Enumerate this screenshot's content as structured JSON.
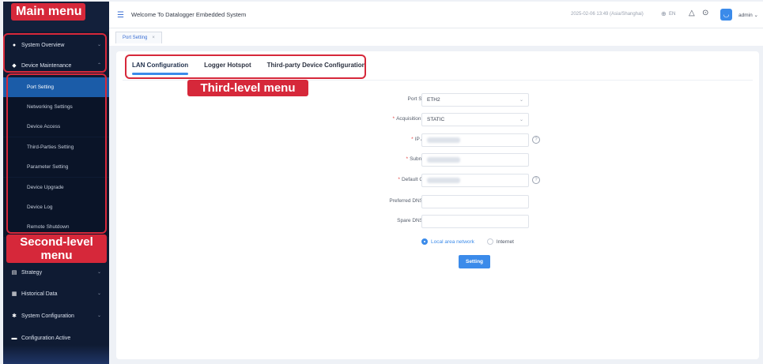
{
  "header": {
    "title": "Welcome To Datalogger Embedded System",
    "datetime": "2025-02-06 13:49 (Asia/Shanghai)",
    "language": "EN",
    "user": "admin"
  },
  "tabs": {
    "open_page": "Port Setting",
    "close_glyph": "×"
  },
  "sidebar": {
    "main_items": [
      {
        "label": "System Overview",
        "icon": "dashboard-icon"
      },
      {
        "label": "Device Maintenance",
        "icon": "device-icon"
      },
      {
        "label": "Strategy",
        "icon": "strategy-icon"
      },
      {
        "label": "Historical Data",
        "icon": "history-icon"
      },
      {
        "label": "System Configuration",
        "icon": "config-icon"
      },
      {
        "label": "Configuration Active",
        "icon": "active-icon"
      }
    ],
    "sub_items": [
      "Port Setting",
      "Networking Settings",
      "Device Access",
      "Third-Parties Setting",
      "Parameter Setting",
      "Device Upgrade",
      "Device Log",
      "Remote Shutdown"
    ],
    "active_sub": "Port Setting"
  },
  "sub_tabs": [
    "LAN Configuration",
    "Logger Hotspot",
    "Third-party Device Configuration"
  ],
  "form": {
    "port_selection": {
      "label": "Port Selection",
      "value": "ETH2"
    },
    "acquisition_method": {
      "label": "Acquisition Method",
      "value": "STATIC"
    },
    "ip_address": {
      "label": "IP Address"
    },
    "subnet_mask": {
      "label": "Subnet Mask"
    },
    "default_gateway": {
      "label": "Default Gateway"
    },
    "preferred_dns": {
      "label": "Preferred DNS Server"
    },
    "spare_dns": {
      "label": "Spare DNS Server"
    },
    "network_options": [
      "Local area network",
      "Internet"
    ],
    "network_selected": "Local area network",
    "submit_label": "Setting"
  },
  "annotations": {
    "main_menu": "Main menu",
    "third_level_menu": "Third-level menu",
    "second_level_menu": "Second-level\nmenu"
  },
  "colors": {
    "sidebar_bg": "#0f1b33",
    "accent": "#3b8bea",
    "annotation_red": "#d6283a"
  }
}
